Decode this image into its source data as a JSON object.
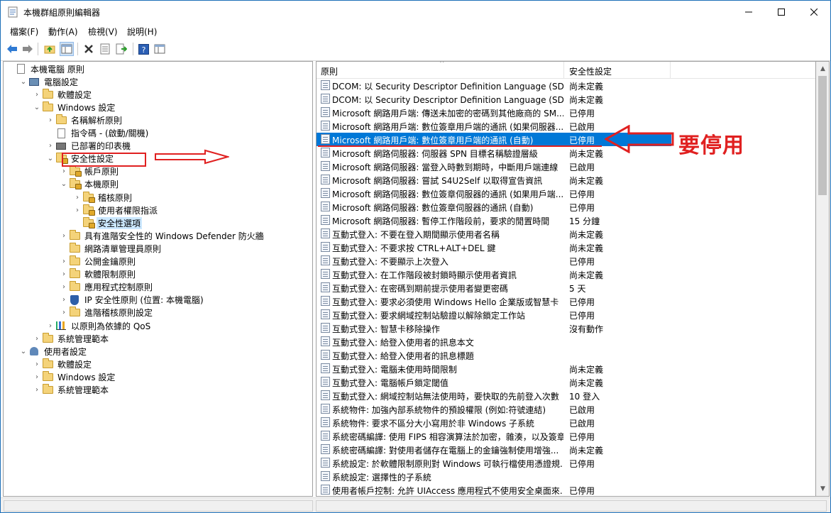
{
  "window": {
    "title": "本機群組原則編輯器"
  },
  "menu": [
    "檔案(F)",
    "動作(A)",
    "檢視(V)",
    "說明(H)"
  ],
  "toolbar": [
    "back-icon",
    "forward-icon",
    "up-folder-icon",
    "show-hide-tree-icon",
    "delete-icon",
    "properties-icon",
    "export-list-icon",
    "help-icon",
    "view-icon"
  ],
  "tree": [
    {
      "label": "本機電腦 原則",
      "level": 0,
      "arrow": "",
      "icon": "doc"
    },
    {
      "label": "電腦設定",
      "level": 1,
      "arrow": "v",
      "icon": "computer"
    },
    {
      "label": "軟體設定",
      "level": 2,
      "arrow": ">",
      "icon": "folder"
    },
    {
      "label": "Windows 設定",
      "level": 2,
      "arrow": "v",
      "icon": "folder"
    },
    {
      "label": "名稱解析原則",
      "level": 3,
      "arrow": ">",
      "icon": "folder"
    },
    {
      "label": "指令碼 - (啟動/關機)",
      "level": 3,
      "arrow": "",
      "icon": "doc"
    },
    {
      "label": "已部署的印表機",
      "level": 3,
      "arrow": ">",
      "icon": "printer"
    },
    {
      "label": "安全性設定",
      "level": 3,
      "arrow": "v",
      "icon": "lockfolder"
    },
    {
      "label": "帳戶原則",
      "level": 4,
      "arrow": ">",
      "icon": "lockfolder"
    },
    {
      "label": "本機原則",
      "level": 4,
      "arrow": "v",
      "icon": "lockfolder"
    },
    {
      "label": "稽核原則",
      "level": 5,
      "arrow": ">",
      "icon": "lockfolder"
    },
    {
      "label": "使用者權限指派",
      "level": 5,
      "arrow": ">",
      "icon": "lockfolder"
    },
    {
      "label": "安全性選項",
      "level": 5,
      "arrow": "",
      "icon": "lockfolder",
      "selected": true
    },
    {
      "label": "具有進階安全性的 Windows Defender 防火牆",
      "level": 4,
      "arrow": ">",
      "icon": "folder"
    },
    {
      "label": "網路清單管理員原則",
      "level": 4,
      "arrow": "",
      "icon": "folder"
    },
    {
      "label": "公開金鑰原則",
      "level": 4,
      "arrow": ">",
      "icon": "folder"
    },
    {
      "label": "軟體限制原則",
      "level": 4,
      "arrow": ">",
      "icon": "folder"
    },
    {
      "label": "應用程式控制原則",
      "level": 4,
      "arrow": ">",
      "icon": "folder"
    },
    {
      "label": "IP 安全性原則 (位置: 本機電腦)",
      "level": 4,
      "arrow": ">",
      "icon": "shield"
    },
    {
      "label": "進階稽核原則設定",
      "level": 4,
      "arrow": ">",
      "icon": "folder"
    },
    {
      "label": "以原則為依據的 QoS",
      "level": 3,
      "arrow": ">",
      "icon": "chart"
    },
    {
      "label": "系統管理範本",
      "level": 2,
      "arrow": ">",
      "icon": "folder"
    },
    {
      "label": "使用者設定",
      "level": 1,
      "arrow": "v",
      "icon": "user"
    },
    {
      "label": "軟體設定",
      "level": 2,
      "arrow": ">",
      "icon": "folder"
    },
    {
      "label": "Windows 設定",
      "level": 2,
      "arrow": ">",
      "icon": "folder"
    },
    {
      "label": "系統管理範本",
      "level": 2,
      "arrow": ">",
      "icon": "folder"
    }
  ],
  "list": {
    "columns": [
      "原則",
      "安全性設定"
    ],
    "rows": [
      [
        "DCOM: 以 Security Descriptor Definition Language (SDD...",
        "尚未定義"
      ],
      [
        "DCOM: 以 Security Descriptor Definition Language (SDD...",
        "尚未定義"
      ],
      [
        "Microsoft 網路用戶端: 傳送未加密的密碼到其他廠商的 SM...",
        "已停用"
      ],
      [
        "Microsoft 網路用戶端: 數位簽章用戶端的通訊 (如果伺服器...",
        "已啟用"
      ],
      [
        "Microsoft 網路用戶端: 數位簽章用戶端的通訊 (自動)",
        "已停用"
      ],
      [
        "Microsoft 網路伺服器: 伺服器 SPN 目標名稱驗證層級",
        "尚未定義"
      ],
      [
        "Microsoft 網路伺服器: 當登入時數到期時，中斷用戶端連線",
        "已啟用"
      ],
      [
        "Microsoft 網路伺服器: 嘗試 S4U2Self 以取得宣告資訊",
        "尚未定義"
      ],
      [
        "Microsoft 網路伺服器: 數位簽章伺服器的通訊 (如果用戶端...",
        "已停用"
      ],
      [
        "Microsoft 網路伺服器: 數位簽章伺服器的通訊 (自動)",
        "已停用"
      ],
      [
        "Microsoft 網路伺服器: 暫停工作階段前，要求的閒置時間",
        "15 分鐘"
      ],
      [
        "互動式登入: 不要在登入期間顯示使用者名稱",
        "尚未定義"
      ],
      [
        "互動式登入: 不要求按 CTRL+ALT+DEL 鍵",
        "尚未定義"
      ],
      [
        "互動式登入: 不要顯示上次登入",
        "已停用"
      ],
      [
        "互動式登入: 在工作階段被封鎖時顯示使用者資訊",
        "尚未定義"
      ],
      [
        "互動式登入: 在密碼到期前提示使用者變更密碼",
        "5 天"
      ],
      [
        "互動式登入: 要求必須使用 Windows Hello 企業版或智慧卡",
        "已停用"
      ],
      [
        "互動式登入: 要求網域控制站驗證以解除鎖定工作站",
        "已停用"
      ],
      [
        "互動式登入: 智慧卡移除操作",
        "沒有動作"
      ],
      [
        "互動式登入: 給登入使用者的訊息本文",
        ""
      ],
      [
        "互動式登入: 給登入使用者的訊息標題",
        ""
      ],
      [
        "互動式登入: 電腦未使用時間限制",
        "尚未定義"
      ],
      [
        "互動式登入: 電腦帳戶鎖定閾值",
        "尚未定義"
      ],
      [
        "互動式登入: 網域控制站無法使用時，要快取的先前登入次數",
        "10 登入"
      ],
      [
        "系統物件: 加強內部系統物件的預設權限 (例如:符號連結)",
        "已啟用"
      ],
      [
        "系統物件: 要求不區分大小寫用於非 Windows 子系統",
        "已啟用"
      ],
      [
        "系統密碼編譯: 使用 FIPS 相容演算法於加密，雜湊，以及簽章",
        "已停用"
      ],
      [
        "系統密碼編譯: 對使用者儲存在電腦上的金鑰強制使用增強...",
        "尚未定義"
      ],
      [
        "系統設定: 於軟體限制原則對 Windows 可執行檔使用憑證規...",
        "已停用"
      ],
      [
        "系統設定: 選擇性的子系統",
        ""
      ],
      [
        "使用者帳戶控制: 允許 UIAccess 應用程式不使用安全桌面來...",
        "已停用"
      ]
    ],
    "selected_index": 4
  },
  "annotation": {
    "text": "要停用",
    "color": "#e02020"
  },
  "colors": {
    "selection": "#0078d7",
    "annotation": "#e02020"
  }
}
